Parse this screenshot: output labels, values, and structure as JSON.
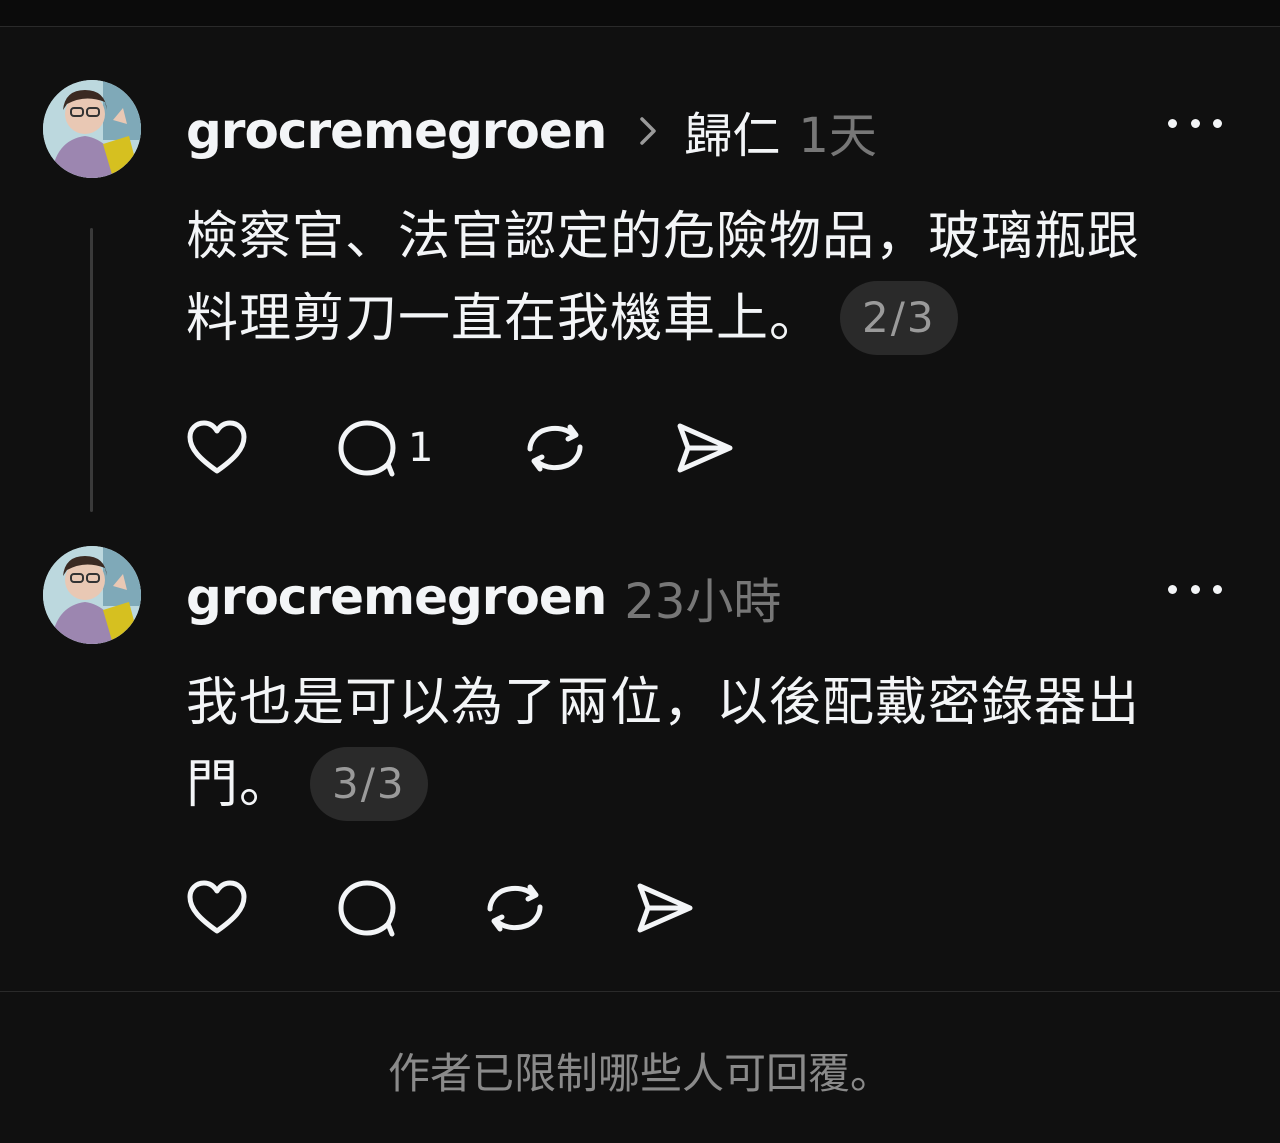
{
  "thread": {
    "posts": [
      {
        "username": "grocremegroen",
        "reply_to": "歸仁",
        "time": "1天",
        "text_line1": "檢察官、法官認定的危險物品，玻璃瓶跟",
        "text_line2": "料理剪刀一直在我機車上。",
        "pager": "2/3",
        "comment_count": "1",
        "avatar_icon": "user-photo-avatar"
      },
      {
        "username": "grocremegroen",
        "time": "23小時",
        "text_line1": "我也是可以為了兩位，以後配戴密錄器出",
        "text_line2": "門。",
        "pager": "3/3",
        "avatar_icon": "user-photo-avatar"
      }
    ]
  },
  "footer": {
    "note": "作者已限制哪些人可回覆。"
  },
  "colors": {
    "background": "#101010",
    "text": "#f3f5f7",
    "muted": "#777777",
    "pill": "#2a2a2a"
  }
}
